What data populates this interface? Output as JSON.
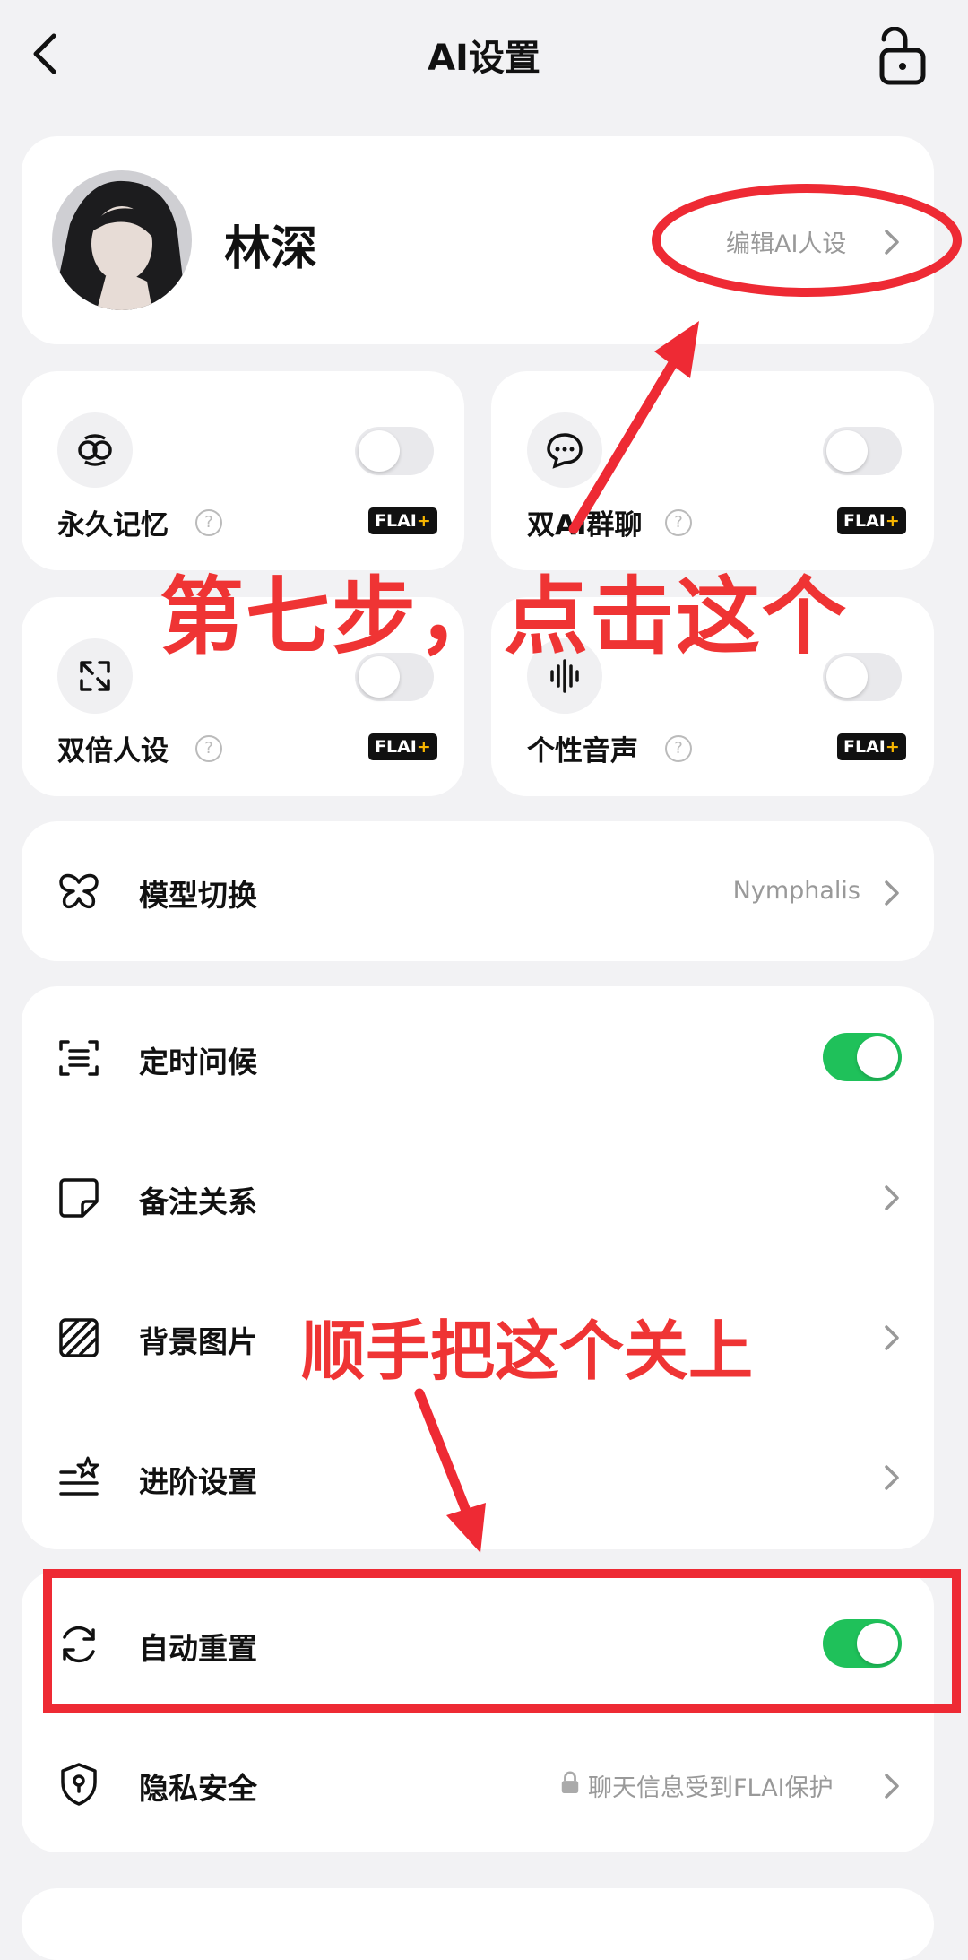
{
  "header": {
    "title": "AI设置"
  },
  "profile": {
    "name": "林深",
    "edit_label": "编辑AI人设"
  },
  "features": [
    {
      "label": "永久记忆",
      "badge": "FLAI",
      "badge_plus": "+",
      "toggle": "off"
    },
    {
      "label": "双AI群聊",
      "badge": "FLAI",
      "badge_plus": "+",
      "toggle": "off"
    },
    {
      "label": "双倍人设",
      "badge": "FLAI",
      "badge_plus": "+",
      "toggle": "off"
    },
    {
      "label": "个性音声",
      "badge": "FLAI",
      "badge_plus": "+",
      "toggle": "off"
    }
  ],
  "model": {
    "label": "模型切换",
    "value": "Nymphalis"
  },
  "settings": {
    "greeting": {
      "label": "定时问候",
      "toggle": "on"
    },
    "note": {
      "label": "备注关系"
    },
    "background": {
      "label": "背景图片"
    },
    "advanced": {
      "label": "进阶设置"
    }
  },
  "reset": {
    "label": "自动重置",
    "toggle": "on"
  },
  "privacy": {
    "label": "隐私安全",
    "value": "聊天信息受到FLAI保护"
  },
  "annotations": {
    "step7": "第七步，点击这个",
    "close_this": "顺手把这个关上"
  },
  "colors": {
    "accent_green": "#1fc15a",
    "annotation_red": "#ee2a34"
  }
}
